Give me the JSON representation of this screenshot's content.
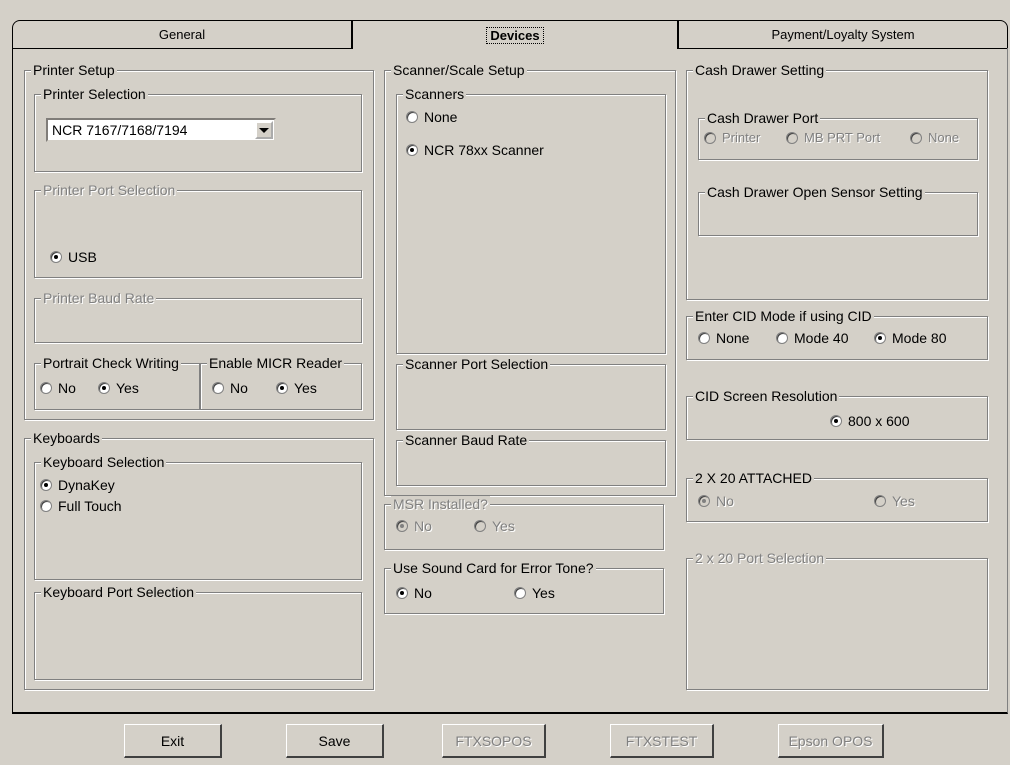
{
  "tabs": {
    "general": "General",
    "devices": "Devices",
    "payment": "Payment/Loyalty System"
  },
  "printer": {
    "setup_title": "Printer Setup",
    "selection_title": "Printer Selection",
    "selected": "NCR 7167/7168/7194",
    "port_title": "Printer Port Selection",
    "port_option": "USB",
    "baud_title": "Printer Baud Rate",
    "portrait_title": "Portrait Check Writing",
    "micr_title": "Enable MICR Reader",
    "no": "No",
    "yes": "Yes"
  },
  "keyboards": {
    "title": "Keyboards",
    "selection_title": "Keyboard Selection",
    "dynakey": "DynaKey",
    "fulltouch": "Full Touch",
    "port_title": "Keyboard Port Selection"
  },
  "scanner": {
    "setup_title": "Scanner/Scale Setup",
    "scanners_title": "Scanners",
    "none": "None",
    "ncr": "NCR 78xx Scanner",
    "port_title": "Scanner Port Selection",
    "baud_title": "Scanner Baud Rate"
  },
  "msr": {
    "title": "MSR Installed?",
    "no": "No",
    "yes": "Yes"
  },
  "sound": {
    "title": "Use Sound Card for Error Tone?",
    "no": "No",
    "yes": "Yes"
  },
  "cash_drawer": {
    "title": "Cash Drawer Setting",
    "port_title": "Cash Drawer Port",
    "printer": "Printer",
    "mb_prt": "MB PRT Port",
    "none": "None",
    "sensor_title": "Cash Drawer Open Sensor Setting"
  },
  "cid": {
    "mode_title": "Enter CID Mode if using CID",
    "none": "None",
    "mode40": "Mode 40",
    "mode80": "Mode 80",
    "res_title": "CID Screen Resolution",
    "res": "800  x 600"
  },
  "attached": {
    "title": "2 X 20 ATTACHED",
    "no": "No",
    "yes": "Yes",
    "port_title": "2 x 20 Port Selection"
  },
  "buttons": {
    "exit": "Exit",
    "save": "Save",
    "ftxsopos": "FTXSOPOS",
    "ftxstest": "FTXSTEST",
    "epson": "Epson OPOS"
  }
}
